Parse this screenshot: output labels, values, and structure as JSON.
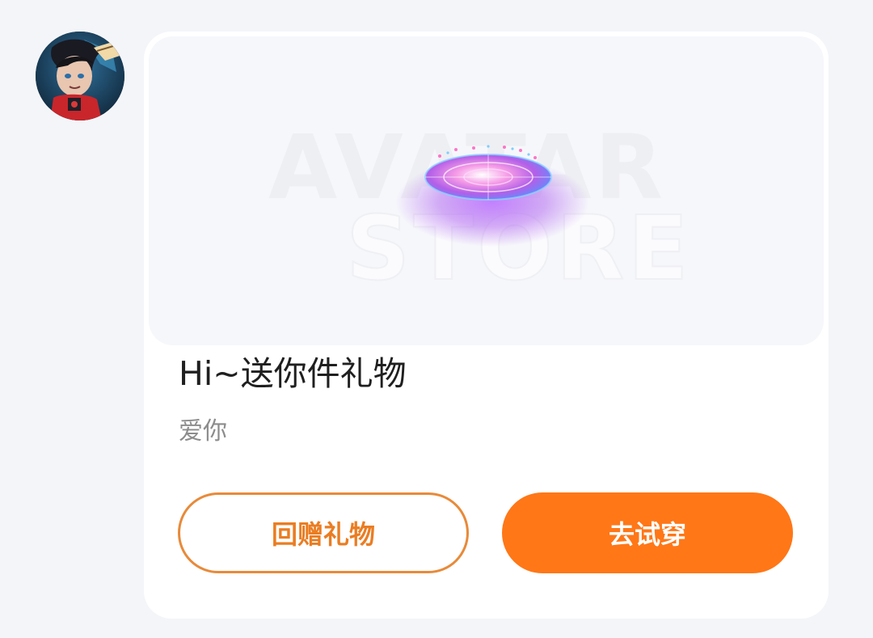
{
  "sender": {
    "avatar_icon": "user-avatar"
  },
  "gift_card": {
    "banner": {
      "watermark_line1": "AVATAR",
      "watermark_line2": "STORE",
      "item_icon": "glowing-disc-gift-icon",
      "glow_colors": [
        "#f06ad8",
        "#7b62ff",
        "#c07bff"
      ]
    },
    "title": "Hi~送你件礼物",
    "message": "爱你",
    "buttons": {
      "return_gift": "回赠礼物",
      "try_on": "去试穿"
    },
    "colors": {
      "accent": "#ff7717",
      "accent_outline": "#e88a3a"
    }
  }
}
